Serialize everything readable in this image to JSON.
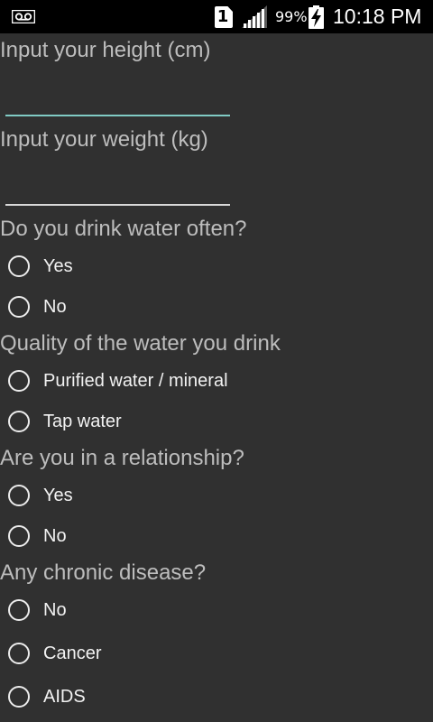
{
  "status_bar": {
    "sim_slot": "1",
    "battery_percent": "99%",
    "time": "10:18 PM",
    "icons": [
      "voicemail-icon",
      "sim-card-icon",
      "signal-icon",
      "battery-charging-icon"
    ]
  },
  "form": {
    "height": {
      "label": "Input your height (cm)",
      "value": "",
      "placeholder": ""
    },
    "weight": {
      "label": "Input your weight (kg)",
      "value": "",
      "placeholder": ""
    },
    "water_often": {
      "question": "Do you drink water often?",
      "options": [
        "Yes",
        "No"
      ]
    },
    "water_quality": {
      "question": "Quality of the water you drink",
      "options": [
        "Purified water / mineral",
        "Tap water"
      ]
    },
    "relationship": {
      "question": "Are you in a relationship?",
      "options": [
        "Yes",
        "No"
      ]
    },
    "chronic_disease": {
      "question": "Any chronic disease?",
      "options": [
        "No",
        "Cancer",
        "AIDS"
      ]
    }
  },
  "colors": {
    "background": "#303030",
    "status_bar": "#000000",
    "question_text": "#bdbdbd",
    "accent_focused_underline": "#80cbc4"
  }
}
